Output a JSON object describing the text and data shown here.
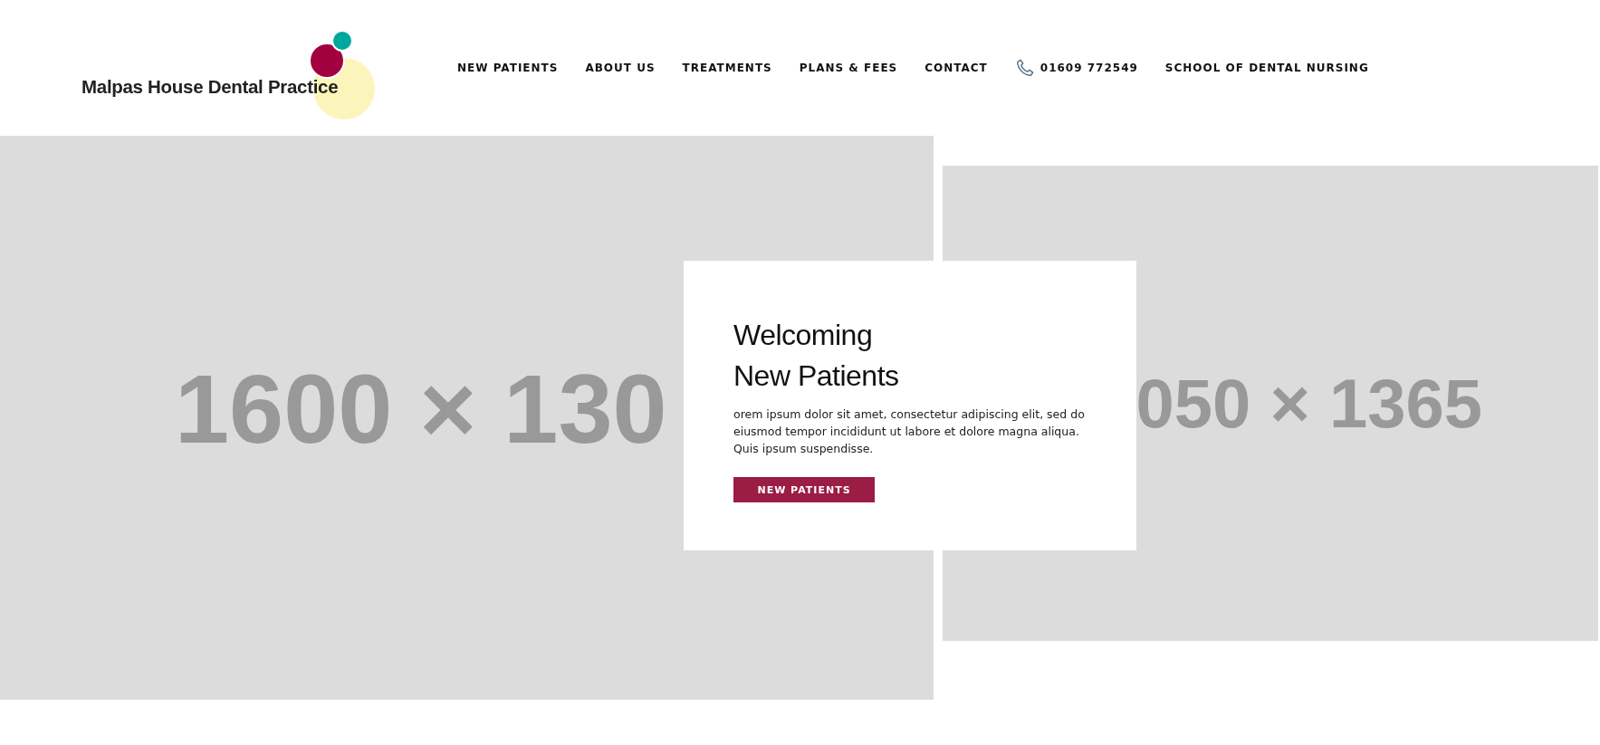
{
  "header": {
    "logo_text": "Malpas House Dental Practice",
    "nav": [
      {
        "label": "NEW PATIENTS",
        "kind": "link"
      },
      {
        "label": "ABOUT US",
        "kind": "link"
      },
      {
        "label": "TREATMENTS",
        "kind": "link"
      },
      {
        "label": "PLANS & FEES",
        "kind": "link"
      },
      {
        "label": "CONTACT",
        "kind": "link"
      },
      {
        "label": "01609 772549",
        "kind": "phone"
      },
      {
        "label": "SCHOOL OF DENTAL NURSING",
        "kind": "link"
      }
    ]
  },
  "hero": {
    "images": [
      {
        "placeholder_text": "1600 × 130"
      },
      {
        "placeholder_text": "050 × 1365"
      }
    ],
    "card": {
      "title_lines": [
        "Welcoming",
        "New Patients"
      ],
      "body": "orem ipsum dolor sit amet, consectetur adipiscing elit, sed do eiusmod tempor incididunt ut labore et dolore magna aliqua. Quis ipsum suspendisse.",
      "button": "NEW PATIENTS"
    }
  }
}
